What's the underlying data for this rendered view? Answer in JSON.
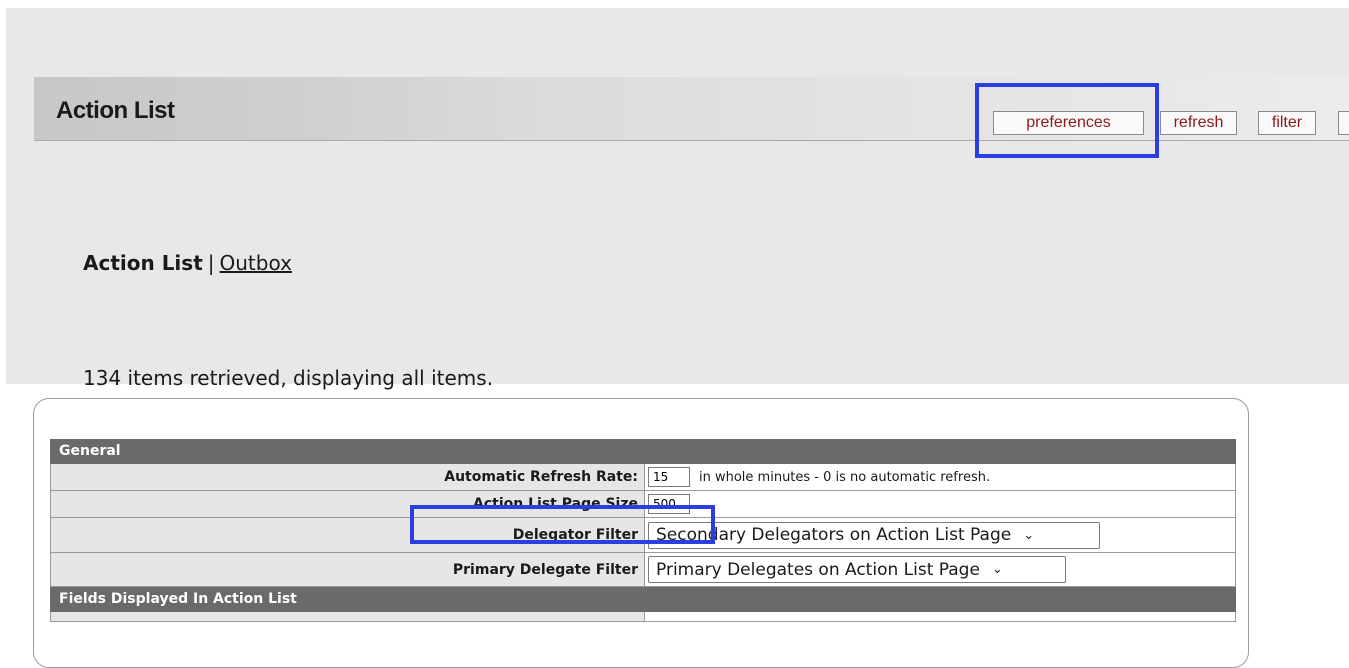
{
  "header": {
    "title": "Action List",
    "buttons": {
      "preferences": "preferences",
      "refresh": "refresh",
      "filter": "filter"
    }
  },
  "subnav": {
    "current": "Action List",
    "separator": "|",
    "outbox": "Outbox"
  },
  "status": "134 items retrieved, displaying all items.",
  "preferences": {
    "general_header": "General",
    "refresh_rate": {
      "label": "Automatic Refresh Rate:",
      "value": "15",
      "hint": "in whole minutes - 0 is no automatic refresh."
    },
    "page_size": {
      "label": "Action List Page Size",
      "value": "500"
    },
    "delegator_filter": {
      "label": "Delegator Filter",
      "selected": "Secondary Delegators on Action List Page"
    },
    "primary_delegate_filter": {
      "label": "Primary Delegate Filter",
      "selected": "Primary Delegates on Action List Page"
    },
    "fields_header": "Fields Displayed In Action List"
  },
  "colors": {
    "highlight": "#2c3ee0",
    "button_text": "#8b1a1a",
    "section_header_bg": "#6a6a6a"
  },
  "icons": {
    "dropdown": "chevron-down-icon"
  }
}
